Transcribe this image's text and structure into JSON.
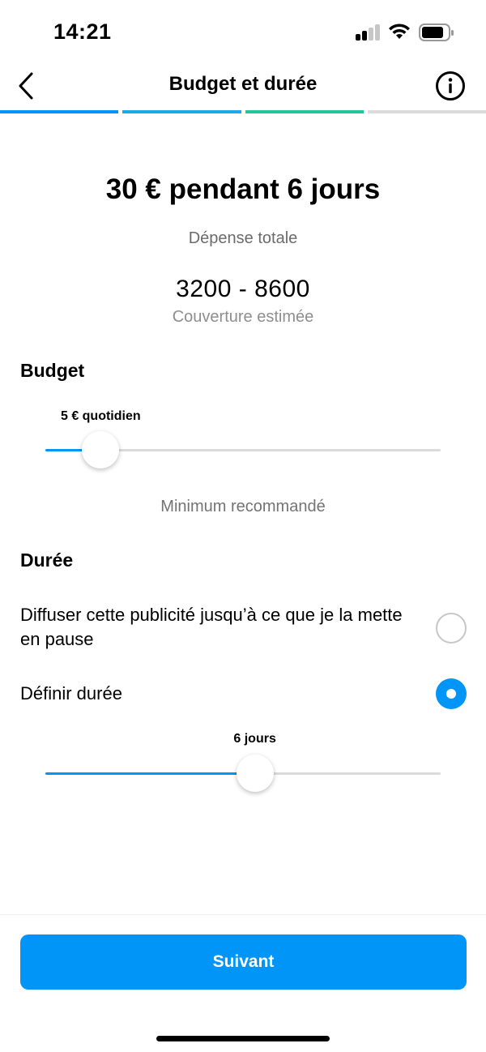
{
  "status_bar": {
    "time": "14:21",
    "icons": [
      "signal-icon",
      "wifi-icon",
      "battery-icon"
    ]
  },
  "nav": {
    "title": "Budget et durée",
    "back_icon": "chevron-left-icon",
    "info_icon": "info-icon"
  },
  "progress": {
    "segments": [
      "#0095f6",
      "#1fa8e8",
      "#1fc79a",
      "#dbdbdb"
    ]
  },
  "summary": {
    "title": "30 € pendant 6 jours",
    "subtitle": "Dépense totale",
    "reach_value": "3200 - 8600",
    "reach_label": "Couverture estimée"
  },
  "budget": {
    "heading": "Budget",
    "slider_label": "5 € quotidien",
    "slider_fraction": 0.14,
    "hint": "Minimum recommandé"
  },
  "duration": {
    "heading": "Durée",
    "options": [
      {
        "label": "Diffuser cette publicité jusqu’à ce que je la mette en pause",
        "selected": false
      },
      {
        "label": "Définir durée",
        "selected": true
      }
    ],
    "slider_label": "6 jours",
    "slider_fraction": 0.53
  },
  "footer": {
    "next_label": "Suivant"
  },
  "colors": {
    "accent": "#0095f6",
    "muted_text": "#737373",
    "track": "#dbdbdb"
  }
}
